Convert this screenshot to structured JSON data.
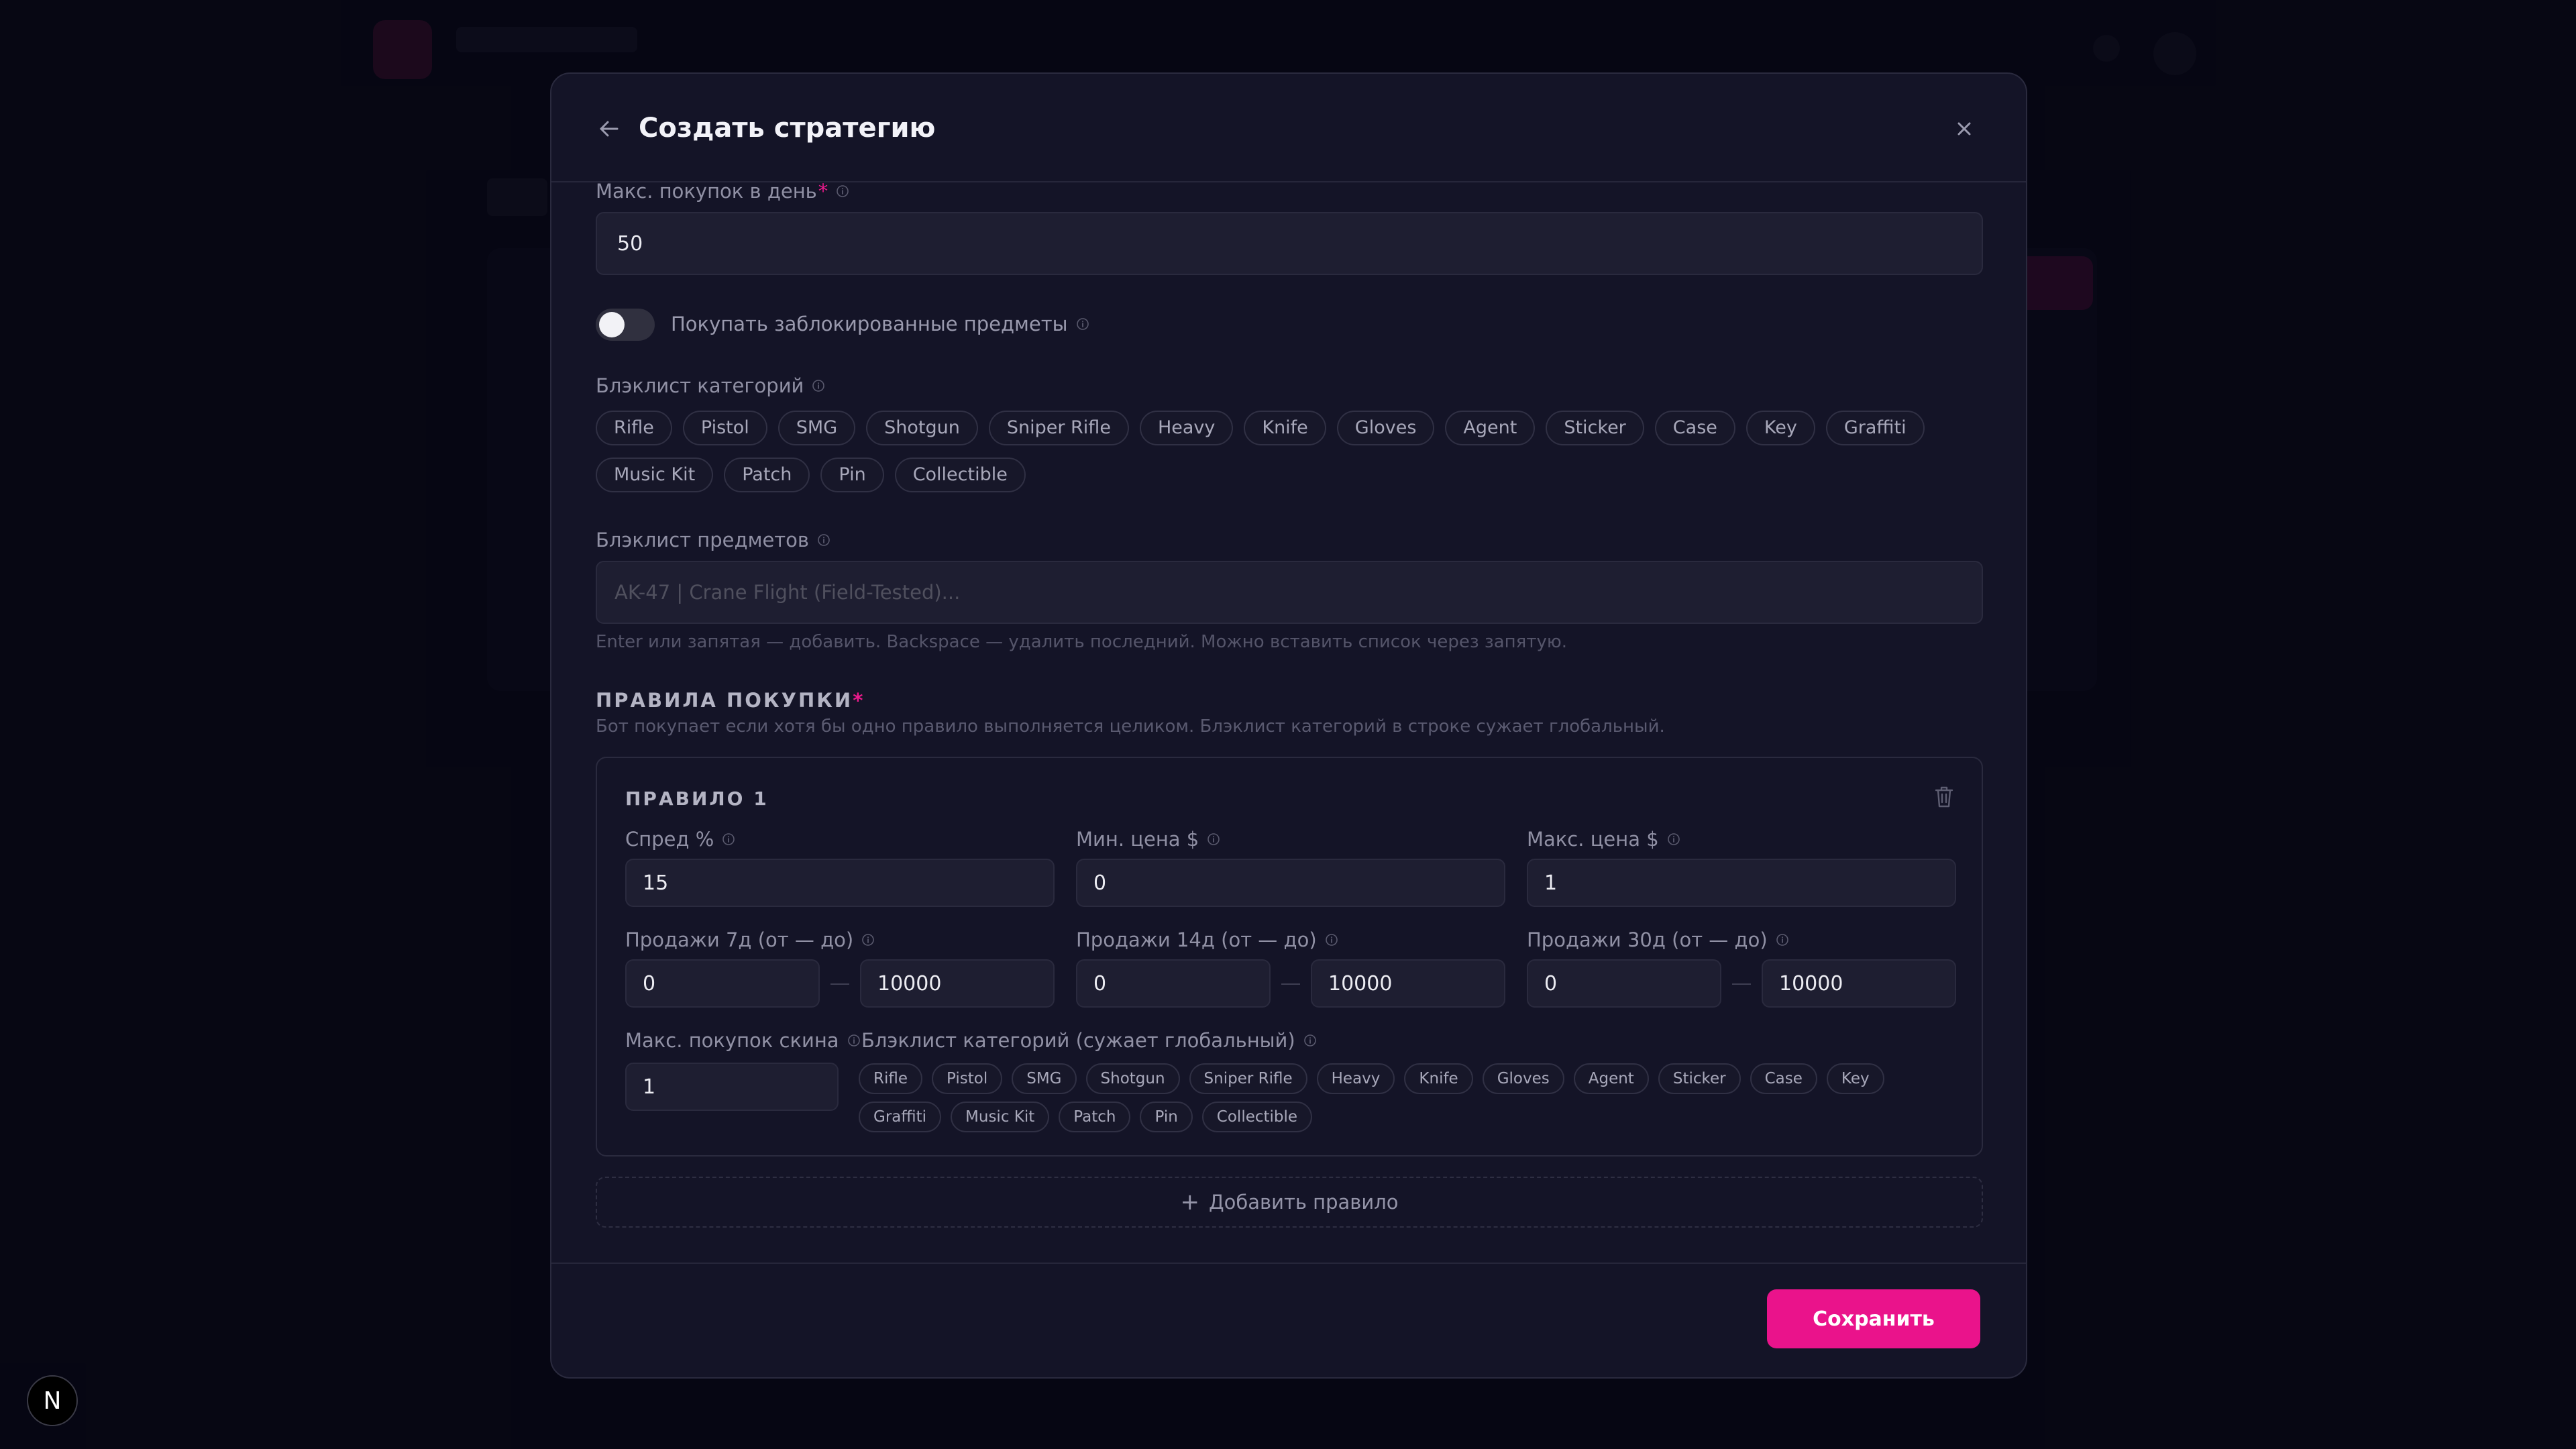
{
  "modal": {
    "title": "Создать стратегию",
    "back_icon": "arrow-left-icon",
    "close_icon": "close-icon"
  },
  "max_purchases_per_day": {
    "label": "Макс. покупок в день",
    "required": "*",
    "value": "50"
  },
  "buy_locked_items": {
    "label": "Покупать заблокированные предметы",
    "enabled": false
  },
  "category_blacklist": {
    "label": "Блэклист категорий",
    "chips": [
      "Rifle",
      "Pistol",
      "SMG",
      "Shotgun",
      "Sniper Rifle",
      "Heavy",
      "Knife",
      "Gloves",
      "Agent",
      "Sticker",
      "Case",
      "Key",
      "Graffiti",
      "Music Kit",
      "Patch",
      "Pin",
      "Collectible"
    ]
  },
  "item_blacklist": {
    "label": "Блэклист предметов",
    "placeholder": "AK-47 | Crane Flight (Field-Tested)...",
    "help": "Enter или запятая — добавить. Backspace — удалить последний. Можно вставить список через запятую."
  },
  "purchase_rules": {
    "title": "ПРАВИЛА ПОКУПКИ",
    "required": "*",
    "description": "Бот покупает если хотя бы одно правило выполняется целиком. Блэклист категорий в строке сужает глобальный.",
    "rules": [
      {
        "title": "ПРАВИЛО 1",
        "spread_label": "Спред %",
        "spread_value": "15",
        "min_price_label": "Мин. цена $",
        "min_price_value": "0",
        "max_price_label": "Макс. цена $",
        "max_price_value": "1",
        "sales7_label": "Продажи 7д (от — до)",
        "sales7_from": "0",
        "sales7_to": "10000",
        "sales14_label": "Продажи 14д (от — до)",
        "sales14_from": "0",
        "sales14_to": "10000",
        "sales30_label": "Продажи 30д (от — до)",
        "sales30_from": "0",
        "sales30_to": "10000",
        "max_skin_label": "Макс. покупок скина",
        "max_skin_value": "1",
        "category_blacklist_label": "Блэклист категорий (сужает глобальный)",
        "category_blacklist_chips": [
          "Rifle",
          "Pistol",
          "SMG",
          "Shotgun",
          "Sniper Rifle",
          "Heavy",
          "Knife",
          "Gloves",
          "Agent",
          "Sticker",
          "Case",
          "Key",
          "Graffiti",
          "Music Kit",
          "Patch",
          "Pin",
          "Collectible"
        ]
      }
    ],
    "add_rule_label": "Добавить правило"
  },
  "save_label": "Сохранить",
  "badge_letter": "N",
  "colors": {
    "accent": "#ea138b",
    "modal_bg": "#141427",
    "input_bg": "#1e1e31"
  }
}
